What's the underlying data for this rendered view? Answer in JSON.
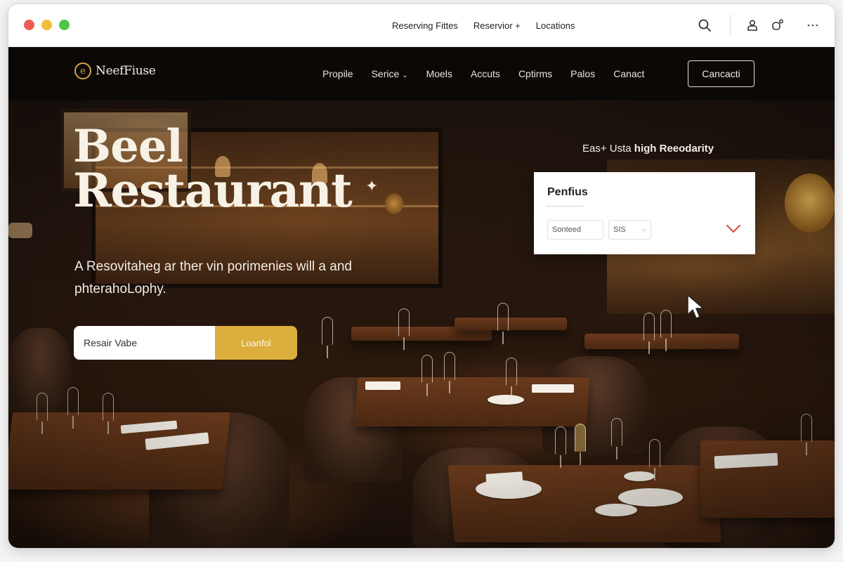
{
  "chrome": {
    "links": [
      "Reserving Fittes",
      "Reservior +",
      "Locations"
    ],
    "icons": [
      "search-icon",
      "user-icon",
      "share-icon",
      "more-icon"
    ]
  },
  "nav": {
    "logo": "NeefFiuse",
    "logo_sub": "",
    "links": [
      "Propile",
      "Serice",
      "Moels",
      "Accuts",
      "Cptirms",
      "Palos",
      "Canact"
    ],
    "cta": "Cancacti"
  },
  "hero": {
    "title_line1": "Beel",
    "title_line2": "Restaurant",
    "subtitle": "A Resovitaheg ar ther vin porimenies will a and phterahoLophy.",
    "input_placeholder": "Resair Vabe",
    "button": "Loanfol"
  },
  "tagline": {
    "prefix": "Eas+ Usta ",
    "bold": "high Reeodarity"
  },
  "card": {
    "title": "Penfius",
    "select1": "Sonteed",
    "select2": "SIS"
  },
  "colors": {
    "accent": "#dcae3e",
    "nav_bg": "#0b0806",
    "logo_gold": "#d9a04b",
    "chevron_red": "#d9473b"
  }
}
